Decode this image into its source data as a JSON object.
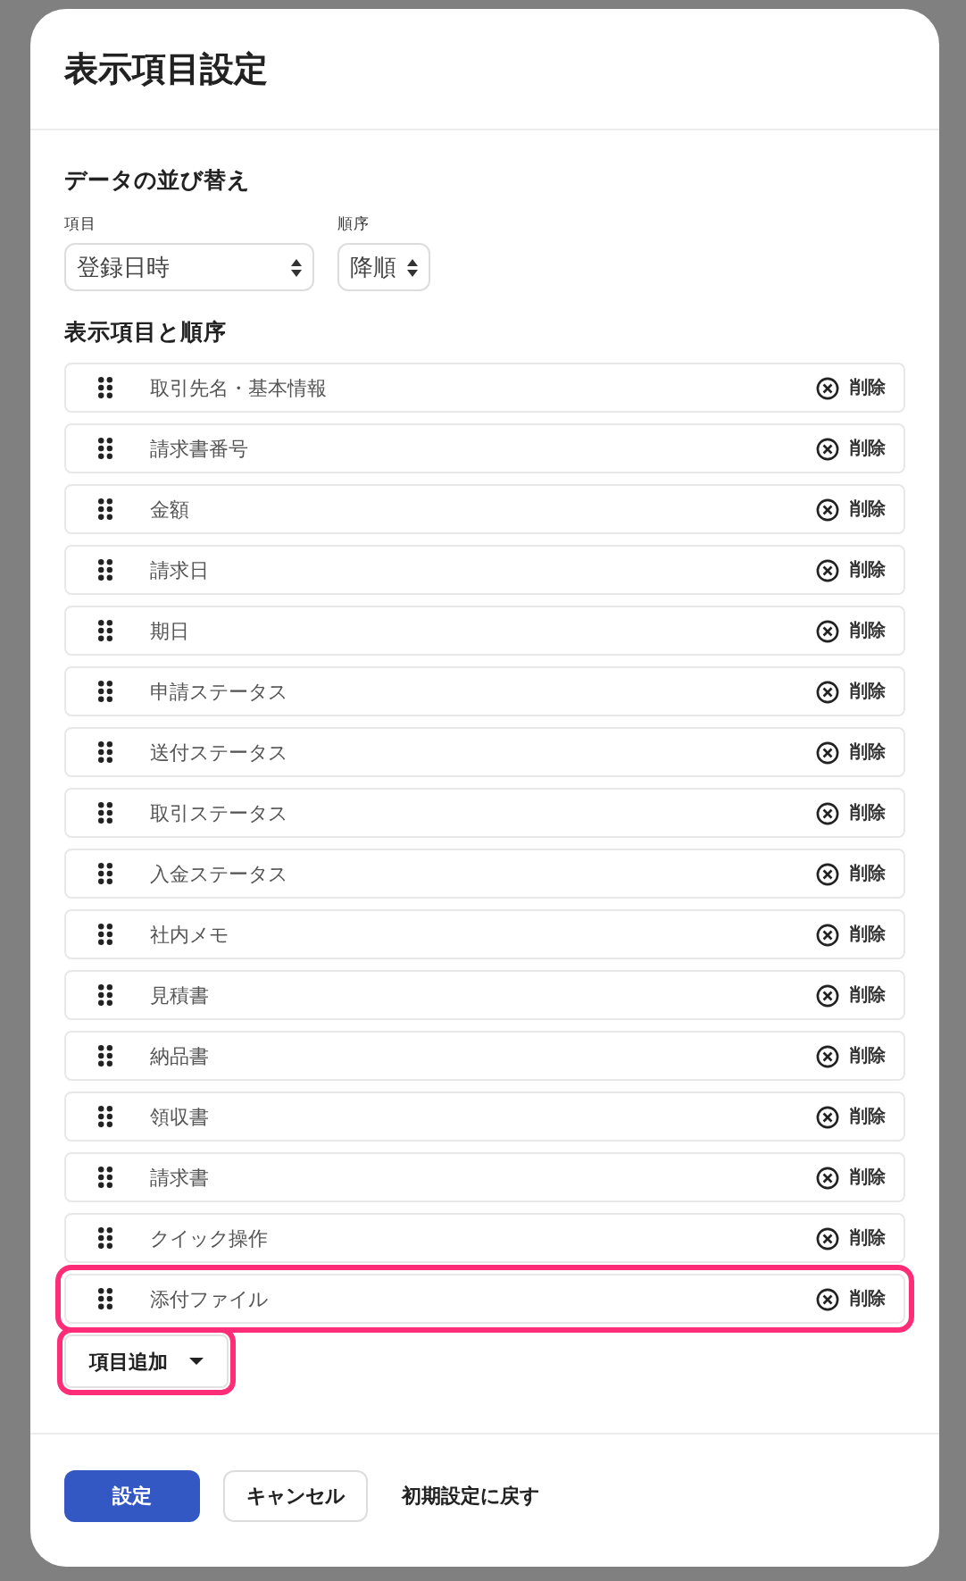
{
  "dialog": {
    "title": "表示項目設定"
  },
  "sort": {
    "heading": "データの並び替え",
    "field_label": "項目",
    "field_value": "登録日時",
    "order_label": "順序",
    "order_value": "降順"
  },
  "columns": {
    "heading": "表示項目と順序",
    "items": [
      {
        "label": "取引先名・基本情報",
        "delete": "削除",
        "highlighted": false
      },
      {
        "label": "請求書番号",
        "delete": "削除",
        "highlighted": false
      },
      {
        "label": "金額",
        "delete": "削除",
        "highlighted": false
      },
      {
        "label": "請求日",
        "delete": "削除",
        "highlighted": false
      },
      {
        "label": "期日",
        "delete": "削除",
        "highlighted": false
      },
      {
        "label": "申請ステータス",
        "delete": "削除",
        "highlighted": false
      },
      {
        "label": "送付ステータス",
        "delete": "削除",
        "highlighted": false
      },
      {
        "label": "取引ステータス",
        "delete": "削除",
        "highlighted": false
      },
      {
        "label": "入金ステータス",
        "delete": "削除",
        "highlighted": false
      },
      {
        "label": "社内メモ",
        "delete": "削除",
        "highlighted": false
      },
      {
        "label": "見積書",
        "delete": "削除",
        "highlighted": false
      },
      {
        "label": "納品書",
        "delete": "削除",
        "highlighted": false
      },
      {
        "label": "領収書",
        "delete": "削除",
        "highlighted": false
      },
      {
        "label": "請求書",
        "delete": "削除",
        "highlighted": false
      },
      {
        "label": "クイック操作",
        "delete": "削除",
        "highlighted": false
      },
      {
        "label": "添付ファイル",
        "delete": "削除",
        "highlighted": true
      }
    ],
    "add_button": {
      "label": "項目追加",
      "highlighted": true
    }
  },
  "footer": {
    "buttons": [
      {
        "label": "設定",
        "kind": "primary"
      },
      {
        "label": "キャンセル",
        "kind": "secondary"
      },
      {
        "label": "初期設定に戻す",
        "kind": "text"
      }
    ]
  }
}
